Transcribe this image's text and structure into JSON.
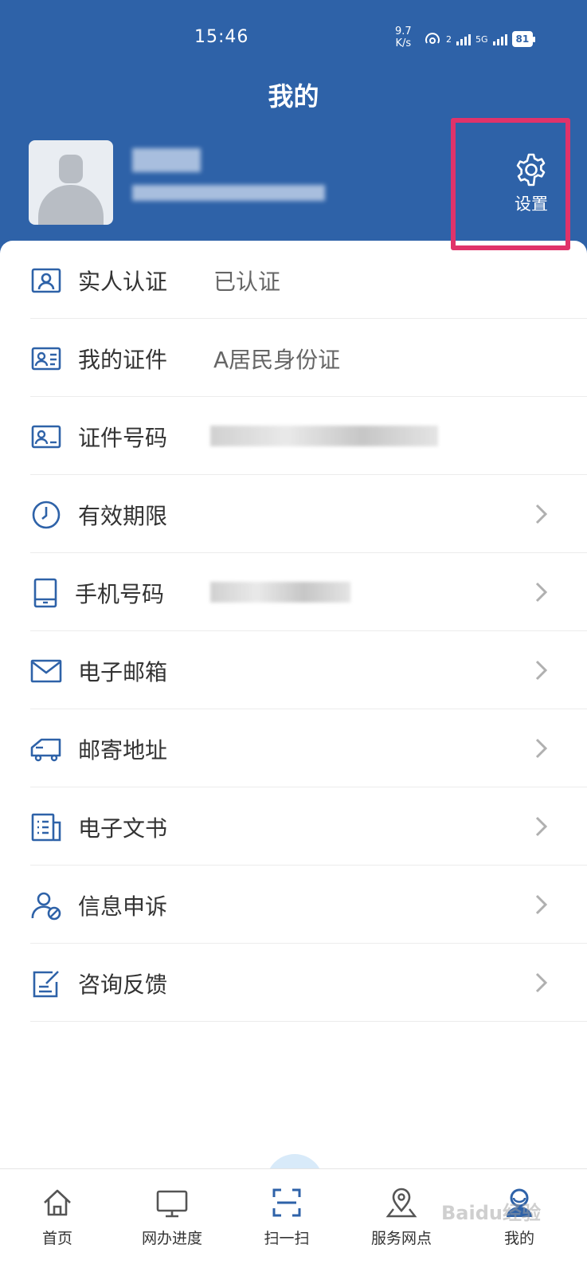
{
  "status_bar": {
    "time": "15:46",
    "speed_value": "9.7",
    "speed_unit": "K/s",
    "signal_a": "2",
    "signal_b": "5G",
    "battery": "81"
  },
  "header": {
    "title": "我的",
    "settings_label": "设置"
  },
  "profile": {
    "avatar_icon": "avatar-placeholder-icon"
  },
  "menu": [
    {
      "icon": "id-person-icon",
      "label": "实人认证",
      "value": "已认证",
      "chevron": false
    },
    {
      "icon": "id-card-icon",
      "label": "我的证件",
      "value": "A居民身份证",
      "chevron": false
    },
    {
      "icon": "id-number-icon",
      "label": "证件号码",
      "value": "",
      "chevron": false
    },
    {
      "icon": "clock-icon",
      "label": "有效期限",
      "value": "",
      "chevron": true
    },
    {
      "icon": "phone-icon",
      "label": "手机号码",
      "value": "",
      "chevron": true
    },
    {
      "icon": "mail-icon",
      "label": "电子邮箱",
      "value": "",
      "chevron": true
    },
    {
      "icon": "truck-icon",
      "label": "邮寄地址",
      "value": "",
      "chevron": true
    },
    {
      "icon": "document-icon",
      "label": "电子文书",
      "value": "",
      "chevron": true
    },
    {
      "icon": "user-appeal-icon",
      "label": "信息申诉",
      "value": "",
      "chevron": true
    },
    {
      "icon": "feedback-edit-icon",
      "label": "咨询反馈",
      "value": "",
      "chevron": true
    }
  ],
  "tabbar": [
    {
      "icon": "home-icon",
      "label": "首页"
    },
    {
      "icon": "monitor-icon",
      "label": "网办进度"
    },
    {
      "icon": "scan-icon",
      "label": "扫一扫"
    },
    {
      "icon": "map-pin-icon",
      "label": "服务网点"
    },
    {
      "icon": "user-icon",
      "label": "我的",
      "active": true
    }
  ],
  "colors": {
    "header_bg": "#2e62a8",
    "icon_blue": "#2e62a8",
    "highlight": "#e0336a"
  },
  "watermark": "Baidu经验"
}
